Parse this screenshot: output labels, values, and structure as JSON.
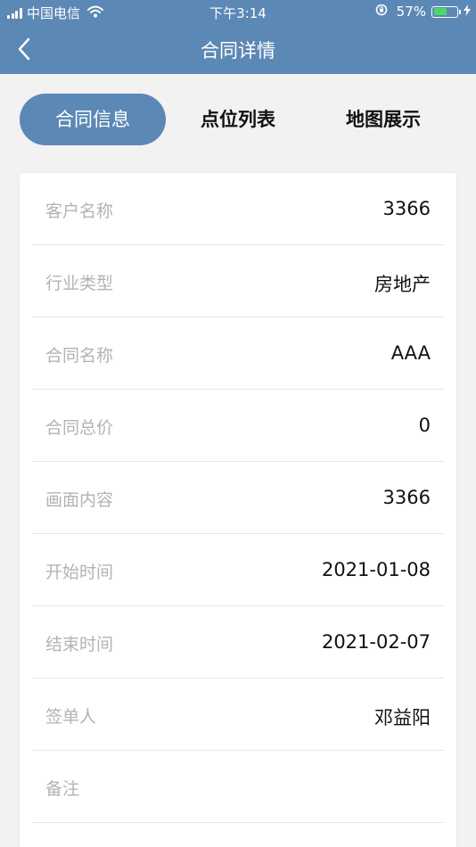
{
  "status_bar": {
    "carrier": "中国电信",
    "time": "下午3:14",
    "battery_percent": "57%",
    "battery_level": 0.57,
    "battery_fill_color": "#4cd964",
    "icons": [
      "signal-bars-icon",
      "wifi-icon",
      "orientation-lock-icon",
      "battery-icon",
      "charging-bolt-icon"
    ]
  },
  "nav": {
    "title": "合同详情",
    "back_icon": "chevron-left-icon"
  },
  "tabs": [
    {
      "label": "合同信息",
      "active": true
    },
    {
      "label": "点位列表",
      "active": false
    },
    {
      "label": "地图展示",
      "active": false
    }
  ],
  "details": [
    {
      "label": "客户名称",
      "value": "3366"
    },
    {
      "label": "行业类型",
      "value": "房地产"
    },
    {
      "label": "合同名称",
      "value": "AAA"
    },
    {
      "label": "合同总价",
      "value": "0"
    },
    {
      "label": "画面内容",
      "value": "3366"
    },
    {
      "label": "开始时间",
      "value": "2021-01-08"
    },
    {
      "label": "结束时间",
      "value": "2021-02-07"
    },
    {
      "label": "签单人",
      "value": "邓益阳"
    },
    {
      "label": "备注",
      "value": ""
    }
  ],
  "colors": {
    "primary": "#5c88b5",
    "background": "#f2f2f2",
    "label_gray": "#b3b3b3",
    "value_text": "#111111",
    "divider": "#e6e6e6"
  }
}
